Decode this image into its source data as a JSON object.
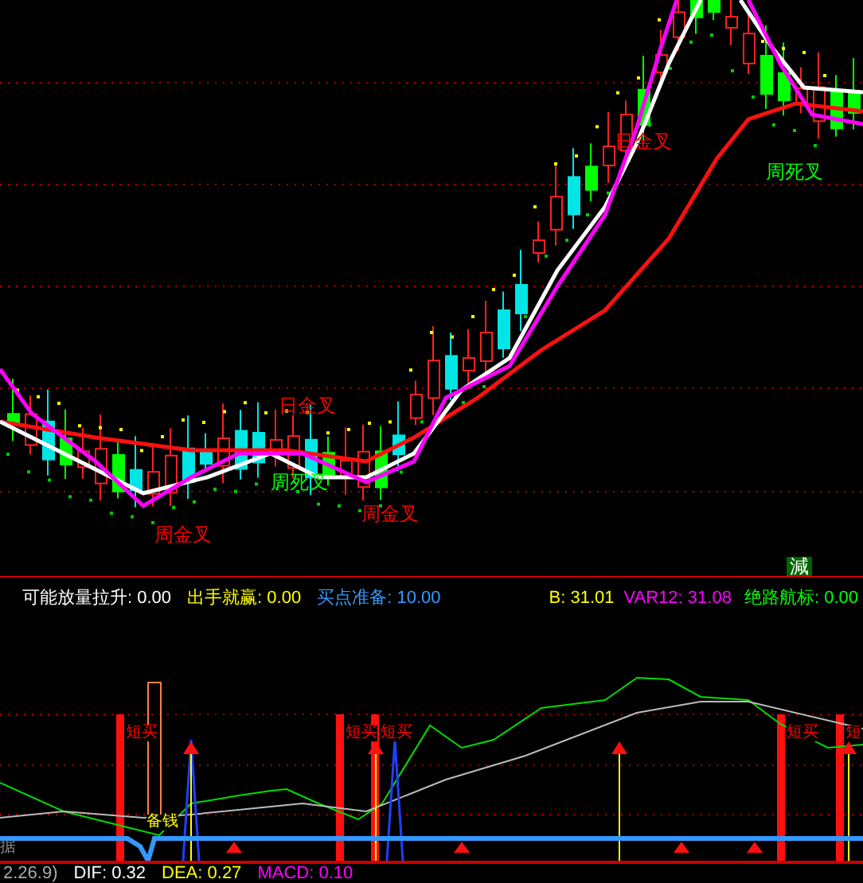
{
  "main_chart": {
    "signals": [
      {
        "text": "日金叉",
        "color": "#ff0000"
      },
      {
        "text": "周死叉",
        "color": "#00ff00"
      },
      {
        "text": "周金叉",
        "color": "#ff0000"
      },
      {
        "text": "周金叉",
        "color": "#ff0000"
      },
      {
        "text": "日金叉",
        "color": "#ff0000"
      },
      {
        "text": "周死叉",
        "color": "#00ff00"
      }
    ],
    "badge": "減"
  },
  "indicator_bar": [
    {
      "label": "可能放量拉升:",
      "value": "0.00",
      "color": "#ffffff"
    },
    {
      "label": "出手就赢:",
      "value": "0.00",
      "color": "#ffff00"
    },
    {
      "label": "买点准备:",
      "value": "10.00",
      "color": "#3399ff"
    },
    {
      "label": "B:",
      "value": "31.01",
      "color": "#ffff00"
    },
    {
      "label": "VAR12:",
      "value": "31.08",
      "color": "#ff00ff"
    },
    {
      "label": "绝路航标:",
      "value": "0.00",
      "color": "#00ff00"
    }
  ],
  "lower_chart": {
    "side_label": "据",
    "signals": [
      {
        "text": "短买",
        "color": "#ff0000"
      },
      {
        "text": "短买",
        "color": "#ff0000"
      },
      {
        "text": "短买",
        "color": "#ff0000"
      },
      {
        "text": "短买",
        "color": "#ff0000"
      },
      {
        "text": "短",
        "color": "#ff0000"
      },
      {
        "text": "备钱",
        "color": "#ffff00"
      }
    ]
  },
  "macd_bar": {
    "params": "2.26.9)",
    "items": [
      {
        "label": "DIF:",
        "value": "0.32",
        "color": "#ffffff"
      },
      {
        "label": "DEA:",
        "value": "0.27",
        "color": "#ffff00"
      },
      {
        "label": "MACD:",
        "value": "0.10",
        "color": "#ff00ff"
      }
    ]
  }
}
